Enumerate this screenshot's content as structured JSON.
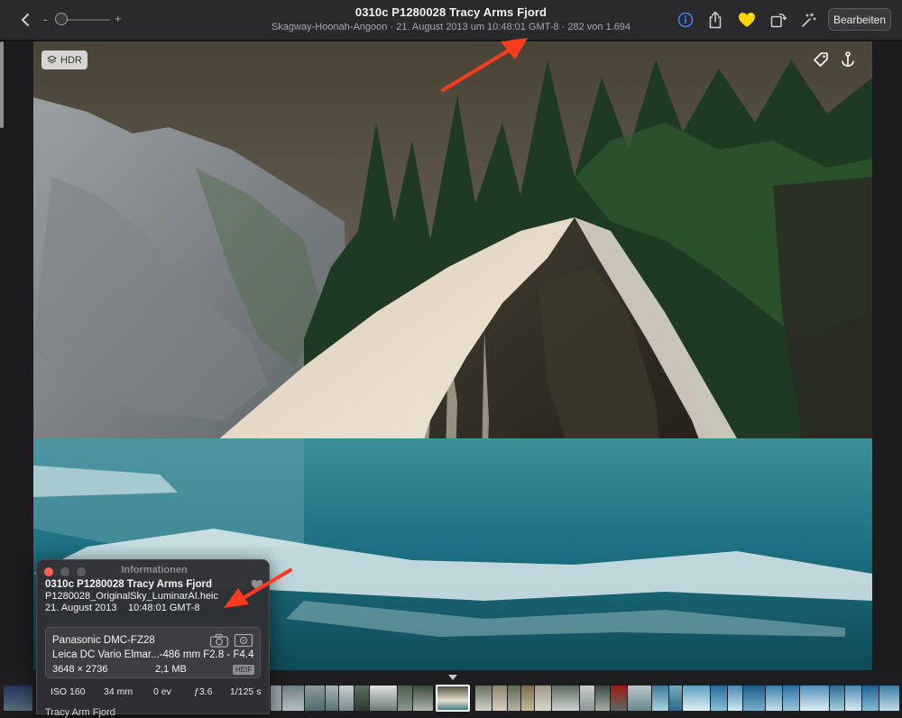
{
  "toolbar": {
    "title": "0310c P1280028 Tracy Arms Fjord",
    "subtitle": "Skagway-Hoonah-Angoon · 21. August 2013 um 10:48:01 GMT-8 · 282 von 1.694",
    "edit_label": "Bearbeiten",
    "zoom_minus": "-",
    "zoom_plus": "+",
    "zoom_level": 0.1,
    "accent_info": "#3b82f6",
    "favorite_color": "#ffd60a"
  },
  "photo": {
    "hdr_label": "HDR"
  },
  "info_panel": {
    "title": "Informationen",
    "name": "0310c P1280028 Tracy Arms Fjord",
    "filename": "P1280028_OriginalSky_LuminarAI.heic",
    "date": "21. August 2013",
    "time": "10:48:01 GMT-8",
    "camera": "Panasonic DMC-FZ28",
    "lens": "Leica DC Vario Elmar...-486 mm F2.8 - F4.4",
    "dimensions": "3648 × 2736",
    "file_size": "2,1 MB",
    "format_badge": "HEIF",
    "exif": {
      "iso": "ISO 160",
      "focal": "34 mm",
      "ev": "0 ev",
      "aperture": "ƒ3.6",
      "shutter": "1/125 s"
    }
  },
  "footer_cut_label": "Tracy Arm Fjord",
  "annotation_color": "#ff3b1f"
}
